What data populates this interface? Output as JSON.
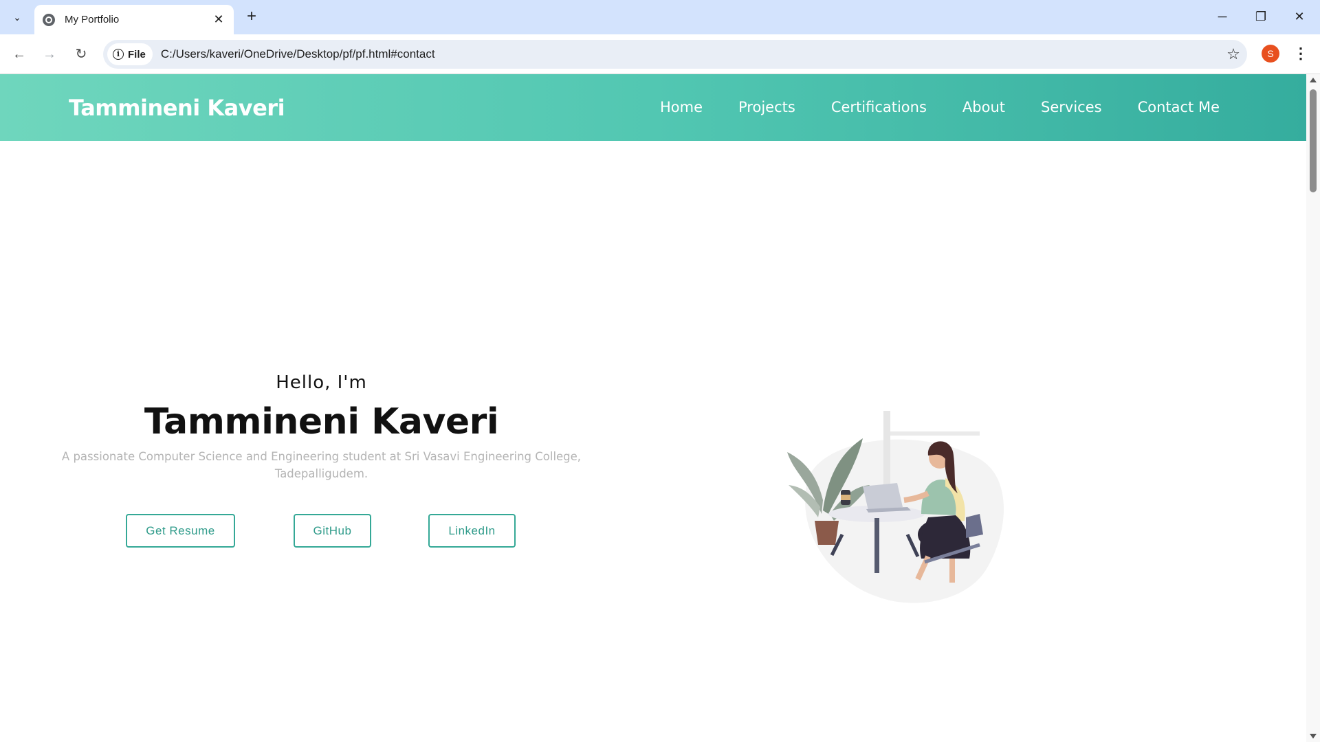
{
  "browser": {
    "tab_title": "My Portfolio",
    "omnibox_chip": "File",
    "url": "C:/Users/kaveri/OneDrive/Desktop/pf/pf.html#contact",
    "profile_initial": "S"
  },
  "site": {
    "brand": "Tammineni Kaveri",
    "nav": [
      "Home",
      "Projects",
      "Certifications",
      "About",
      "Services",
      "Contact Me"
    ]
  },
  "hero": {
    "greeting": "Hello, I'm",
    "name": "Tammineni Kaveri",
    "description": "A passionate Computer Science and Engineering student at Sri Vasavi Engineering College, Tadepalligudem.",
    "buttons": [
      "Get Resume",
      "GitHub",
      "LinkedIn"
    ]
  },
  "colors": {
    "accent": "#34a896",
    "nav_gradient_start": "#6fd6bd",
    "nav_gradient_end": "#35ad9e"
  }
}
